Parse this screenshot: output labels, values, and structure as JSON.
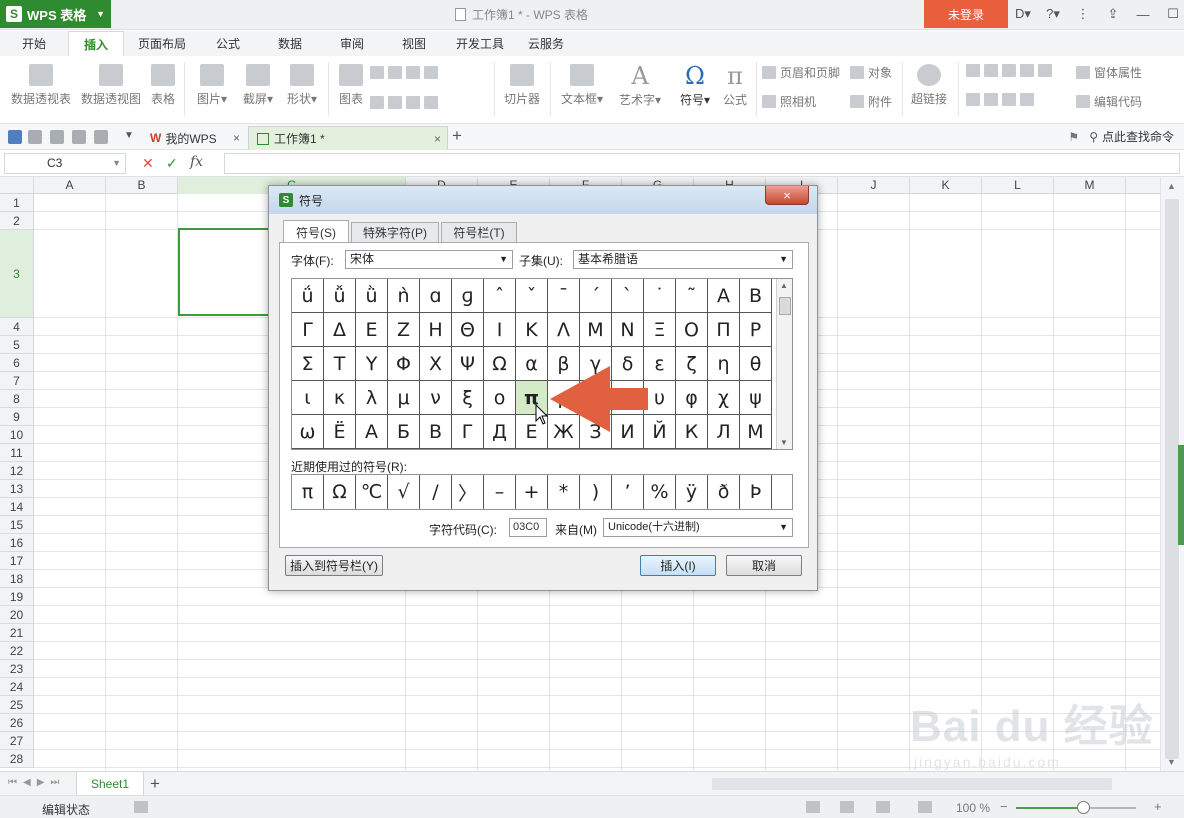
{
  "app": {
    "logo_text": "WPS 表格",
    "window_title": "工作簿1 * - WPS 表格",
    "login_label": "未登录"
  },
  "menu_tabs": [
    "开始",
    "插入",
    "页面布局",
    "公式",
    "数据",
    "审阅",
    "视图",
    "开发工具",
    "云服务"
  ],
  "active_menu": "插入",
  "ribbon": {
    "pivot_table": "数据透视表",
    "pivot_chart": "数据透视图",
    "table": "表格",
    "picture": "图片",
    "screenshot": "截屏",
    "shape": "形状",
    "chart": "图表",
    "slicer": "切片器",
    "textbox": "文本框",
    "wordart": "艺术字",
    "symbol": "符号",
    "formula": "公式",
    "header_footer": "页眉和页脚",
    "object": "对象",
    "camera": "照相机",
    "attachment": "附件",
    "hyperlink": "超链接",
    "window_props": "窗体属性",
    "edit_code": "编辑代码"
  },
  "doc_tabs": {
    "my_wps": "我的WPS",
    "workbook": "工作簿1 *",
    "close": "×",
    "add": "+"
  },
  "command_search": "点此查找命令",
  "formula_bar": {
    "cell_ref": "C3",
    "fx": "fx"
  },
  "columns": [
    "A",
    "B",
    "C",
    "D",
    "E",
    "F",
    "G",
    "H",
    "I",
    "J",
    "K",
    "L",
    "M"
  ],
  "rows": [
    "1",
    "2",
    "3",
    "4",
    "5",
    "6",
    "7",
    "8",
    "9",
    "10",
    "11",
    "12",
    "13",
    "14",
    "15",
    "16",
    "17",
    "18",
    "19",
    "20",
    "21",
    "22",
    "23",
    "24",
    "25",
    "26",
    "27",
    "28"
  ],
  "sheet": {
    "tab_name": "Sheet1",
    "add": "+"
  },
  "status": {
    "mode": "编辑状态",
    "zoom": "100 %",
    "zoom_percent": 100
  },
  "dialog": {
    "title": "符号",
    "close": "×",
    "tabs": [
      "符号(S)",
      "特殊字符(P)",
      "符号栏(T)"
    ],
    "font_label": "字体(F):",
    "font_value": "宋体",
    "subset_label": "子集(U):",
    "subset_value": "基本希腊语",
    "symbols": [
      [
        "ǘ",
        "ǚ",
        "ǜ",
        "ǹ",
        "ɑ",
        "ɡ",
        "ˆ",
        "ˇ",
        "ˉ",
        "ˊ",
        "ˋ",
        "˙",
        "˜",
        "Α",
        "Β"
      ],
      [
        "Γ",
        "Δ",
        "Ε",
        "Ζ",
        "Η",
        "Θ",
        "Ι",
        "Κ",
        "Λ",
        "Μ",
        "Ν",
        "Ξ",
        "Ο",
        "Π",
        "Ρ"
      ],
      [
        "Σ",
        "Τ",
        "Υ",
        "Φ",
        "Χ",
        "Ψ",
        "Ω",
        "α",
        "β",
        "γ",
        "δ",
        "ε",
        "ζ",
        "η",
        "θ"
      ],
      [
        "ι",
        "κ",
        "λ",
        "μ",
        "ν",
        "ξ",
        "ο",
        "π",
        "ρ",
        "σ",
        "τ",
        "υ",
        "φ",
        "χ",
        "ψ"
      ],
      [
        "ω",
        "Ё",
        "А",
        "Б",
        "В",
        "Г",
        "Д",
        "Е",
        "Ж",
        "З",
        "И",
        "Й",
        "К",
        "Л",
        "М"
      ]
    ],
    "selected_symbol": "π",
    "recent_label": "近期使用过的符号(R):",
    "recent": [
      "π",
      "Ω",
      "℃",
      "√",
      "/",
      "〉",
      "–",
      "+",
      "*",
      ")",
      "’",
      "%",
      "ÿ",
      "ð",
      "Þ"
    ],
    "code_label": "字符代码(C):",
    "code_value": "03C0",
    "from_label": "来自(M)",
    "from_value": "Unicode(十六进制)",
    "add_to_bar": "插入到符号栏(Y)",
    "insert": "插入(I)",
    "cancel": "取消"
  },
  "watermark": {
    "brand": "Bai du 经验",
    "url": "jingyan.baidu.com"
  },
  "colors": {
    "wps_green": "#2f8b2f",
    "login_orange": "#e95e3b",
    "arrow_orange": "#e0603f",
    "selection_green": "#3d9a3d"
  }
}
